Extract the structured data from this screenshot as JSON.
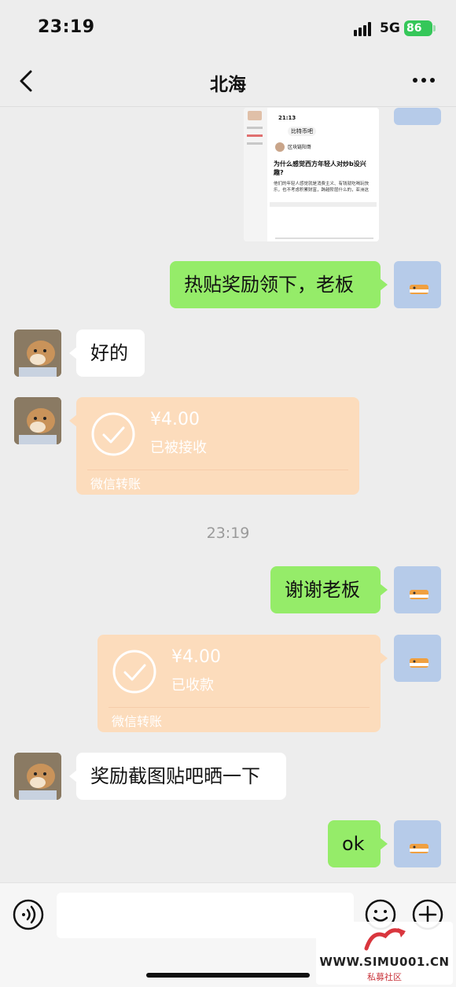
{
  "status_bar": {
    "time": "23:19",
    "network": "5G",
    "battery": "86"
  },
  "nav": {
    "title": "北海"
  },
  "messages": {
    "m1": {
      "text": "热贴奖励领下，老板"
    },
    "m2": {
      "text": "好的"
    },
    "m3": {
      "amount": "¥4.00",
      "status": "已被接收",
      "label": "微信转账"
    },
    "time_divider": "23:19",
    "m4": {
      "text": "谢谢老板"
    },
    "m5": {
      "amount": "¥4.00",
      "status": "已收款",
      "label": "微信转账"
    },
    "m6": {
      "text": "奖励截图贴吧晒一下"
    },
    "m7": {
      "text": "ok"
    }
  },
  "screenshot_thumb": {
    "time": "21:13",
    "forum": "比特币吧",
    "author": "区块链阳哥",
    "post_title": "为什么感觉西方年轻人对炒b没兴趣?",
    "post_snippet": "他们的年轻人感觉就是消费主义、有钱就吃喝玩快乐，也不考虑积累财富，跨越阶层什么的，亚洲这"
  },
  "watermark": {
    "url": "WWW.SIMU001.CN",
    "sub": "私募社区"
  },
  "colors": {
    "outgoing": "#95ec69",
    "incoming": "#ffffff",
    "transfer": "#fcdcbc",
    "background": "#ededed"
  },
  "icons": [
    "back-arrow-icon",
    "more-icon",
    "voice-icon",
    "emoji-icon",
    "plus-icon",
    "check-circle-icon"
  ]
}
